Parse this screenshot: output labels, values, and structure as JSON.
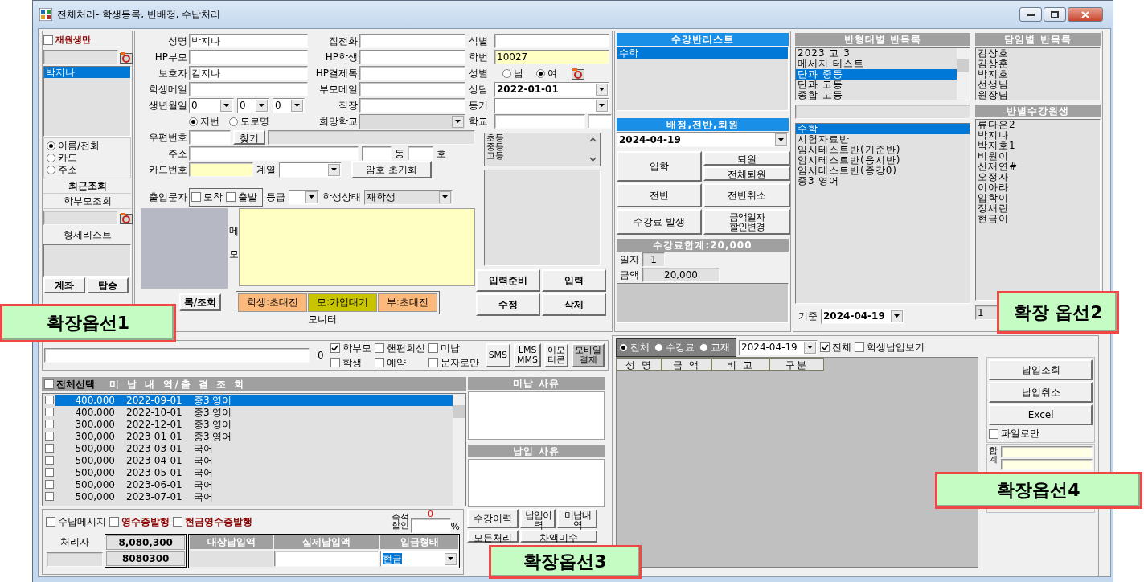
{
  "window": {
    "title": "전체처리- 학생등록, 반배정, 수납처리"
  },
  "search_panel": {
    "enrolled_only": {
      "label": "재원생만",
      "checked": false
    },
    "results": [
      {
        "name": "박지나",
        "selected": true
      }
    ],
    "search_modes": [
      {
        "label": "이름/전화",
        "selected": true
      },
      {
        "label": "카드",
        "selected": false
      },
      {
        "label": "주소",
        "selected": false
      }
    ],
    "recent_button": "최근조회",
    "parent_search_button": "학부모조회",
    "siblings_title": "형제리스트",
    "buttons": [
      "계좌",
      "탑승"
    ]
  },
  "student_form": {
    "name": {
      "label": "성명",
      "value": "박지나"
    },
    "home_phone": {
      "label": "집전화"
    },
    "id_code": {
      "label": "식별"
    },
    "parent_phone": {
      "label": "HP부모"
    },
    "student_phone": {
      "label": "HP학생"
    },
    "student_number": {
      "label": "학번",
      "value": "10027"
    },
    "guardian": {
      "label": "보호자",
      "value": "김지나"
    },
    "payment_talk": {
      "label": "HP결제톡"
    },
    "gender": {
      "label": "성별",
      "options": [
        {
          "label": "남",
          "selected": false
        },
        {
          "label": "여",
          "selected": true
        }
      ]
    },
    "student_email": {
      "label": "학생메일"
    },
    "parent_email": {
      "label": "부모메일"
    },
    "consultation": {
      "label": "상담",
      "value": "2022-01-01"
    },
    "birthdate": {
      "label": "생년월일",
      "values": [
        "0",
        "0",
        "0"
      ]
    },
    "workplace": {
      "label": "직장"
    },
    "motive": {
      "label": "동기"
    },
    "address_type": [
      {
        "label": "지번",
        "selected": true
      },
      {
        "label": "도로명",
        "selected": false
      }
    ],
    "desired_school": {
      "label": "희망학교",
      "disabled": true
    },
    "school": {
      "label": "학교"
    },
    "postcode": {
      "label": "우편번호",
      "button": "찾기"
    },
    "address": {
      "label": "주소",
      "dong_label": "동",
      "ho_label": "호"
    },
    "card_number": {
      "label": "카드번호"
    },
    "track": {
      "label": "계열"
    },
    "reset_password_button": "암호 초기화",
    "entry_sms": {
      "label": "출입문자",
      "options": [
        {
          "label": "도착",
          "checked": false
        },
        {
          "label": "출발",
          "checked": false
        }
      ]
    },
    "grade": {
      "label": "등급"
    },
    "status": {
      "label": "학생상태",
      "value": "재학생"
    },
    "photo_button": "록/조회",
    "memo": {
      "label": [
        "메",
        "모"
      ]
    },
    "app_status": [
      {
        "label": "학생:초대전",
        "color": "#fbb97c"
      },
      {
        "label": "모:가입대기",
        "color": "#c8c400"
      },
      {
        "label": "부:초대전",
        "color": "#fbb97c"
      }
    ],
    "monitor_label": "모니터",
    "school_levels": [
      "초등",
      "중등",
      "고등"
    ],
    "buttons": [
      "입력준비",
      "입력",
      "수정",
      "삭제"
    ]
  },
  "class_panel": {
    "title": "수강반리스트",
    "classes": [
      {
        "name": "수학",
        "selected": true
      }
    ],
    "assign_title": "배정,전반,퇴원",
    "date": "2024-04-19",
    "buttons": [
      "퇴원",
      "입학",
      "전체퇴원",
      "전반",
      "전반취소",
      "수강료   발생",
      "금액일자\n할인변경"
    ],
    "fee_total": "수강료합계:20,000",
    "days": {
      "label": "일자",
      "value": "1"
    },
    "amount": {
      "label": "금액",
      "value": "20,000"
    }
  },
  "class_lists": {
    "by_type": {
      "title": "반형태별 반목록",
      "items": [
        {
          "name": "2023 고 3",
          "selected": false
        },
        {
          "name": "메세지 테스트",
          "selected": false
        },
        {
          "name": "단과 중등",
          "selected": true
        },
        {
          "name": "단과 고등",
          "selected": false
        },
        {
          "name": "종합 고등",
          "selected": false
        }
      ]
    },
    "classes": [
      {
        "name": "수학",
        "selected": true
      },
      {
        "name": "시험자료반",
        "selected": false
      },
      {
        "name": "임시테스트반(기준반)",
        "selected": false
      },
      {
        "name": "임시테스트반(응시반)",
        "selected": false
      },
      {
        "name": "임시테스트반(종강0)",
        "selected": false
      },
      {
        "name": "중3 영어",
        "selected": false
      }
    ],
    "base_date": {
      "label": "기준",
      "value": "2024-04-19"
    },
    "by_teacher": {
      "title": "담임별 반목록",
      "items": [
        "김상호",
        "김상훈",
        "박지호",
        "선생님",
        "원장님"
      ]
    },
    "students": {
      "title": "반별수강원생",
      "items": [
        "류다은2",
        "박지나",
        "박지호1",
        "비원이",
        "신재연#",
        "오정자",
        "이아라",
        "입학이",
        "정새린",
        "현금이"
      ]
    },
    "count_value": "1"
  },
  "message_bar": {
    "count": "0",
    "options": [
      {
        "label": "학부모",
        "checked": true
      },
      {
        "label": "핸편회신",
        "checked": false
      },
      {
        "label": "미납",
        "checked": false
      },
      {
        "label": "학생",
        "checked": false
      },
      {
        "label": "예약",
        "checked": false
      },
      {
        "label": "문자로만",
        "checked": false
      }
    ],
    "buttons": [
      "SMS",
      "LMS\nMMS",
      "이모\n티콘",
      "모바일\n결제"
    ]
  },
  "unpaid": {
    "select_all": {
      "label": "전체선택",
      "checked": false
    },
    "title": "미 납 내 역/출 결 조 회",
    "rows": [
      {
        "amount": "400,000",
        "date": "2022-09-01",
        "class": "중3 영어",
        "checked": false,
        "selected": true
      },
      {
        "amount": "400,000",
        "date": "2022-10-01",
        "class": "중3 영어",
        "checked": false,
        "selected": false
      },
      {
        "amount": "300,000",
        "date": "2022-12-01",
        "class": "중3 영어",
        "checked": false,
        "selected": false
      },
      {
        "amount": "300,000",
        "date": "2023-01-01",
        "class": "중3 영어",
        "checked": false,
        "selected": false
      },
      {
        "amount": "500,000",
        "date": "2023-03-01",
        "class": "국어",
        "checked": false,
        "selected": false
      },
      {
        "amount": "500,000",
        "date": "2023-04-01",
        "class": "국어",
        "checked": false,
        "selected": false
      },
      {
        "amount": "500,000",
        "date": "2023-05-01",
        "class": "국어",
        "checked": false,
        "selected": false
      },
      {
        "amount": "500,000",
        "date": "2023-06-01",
        "class": "국어",
        "checked": false,
        "selected": false
      },
      {
        "amount": "500,000",
        "date": "2023-07-01",
        "class": "국어",
        "checked": false,
        "selected": false
      }
    ],
    "unpaid_reason": {
      "title": "미납 사유"
    },
    "payment_reason": {
      "title": "납입 사유"
    },
    "options": [
      {
        "label": "수납메시지",
        "checked": false,
        "emphasis": false
      },
      {
        "label": "영수증발행",
        "checked": false,
        "emphasis": true
      },
      {
        "label": "현금영수증발행",
        "checked": false,
        "emphasis": true
      }
    ],
    "discount": {
      "label": "즉석\n할인",
      "count": "0",
      "unit": "%"
    },
    "handler": {
      "label": "처리자"
    },
    "totals": [
      "8,080,300",
      "8080300"
    ],
    "columns": [
      "대상납입액",
      "실제납입액",
      "입금형태"
    ],
    "payment_type": "현금",
    "buttons": [
      "수강이력",
      "납입이\n력",
      "미납내\n역",
      "모든처리",
      "차액미수"
    ]
  },
  "payments": {
    "filters": [
      {
        "label": "전체",
        "selected": true
      },
      {
        "label": "수강료",
        "selected": false
      },
      {
        "label": "교재",
        "selected": false
      }
    ],
    "date": "2024-04-19",
    "all": {
      "label": "전체",
      "checked": true
    },
    "show_student": {
      "label": "학생납입보기",
      "checked": false
    },
    "columns": [
      "성 명",
      "금 액",
      "비 고",
      "구분"
    ],
    "buttons": [
      "납입조회",
      "납입취소",
      "Excel"
    ],
    "file_only": {
      "label": "파일로만",
      "checked": false
    },
    "total_label": [
      "합",
      "계"
    ]
  },
  "callouts": [
    "확장옵선1",
    "확장 옵선2",
    "확장옵선3",
    "확장옵선4"
  ]
}
